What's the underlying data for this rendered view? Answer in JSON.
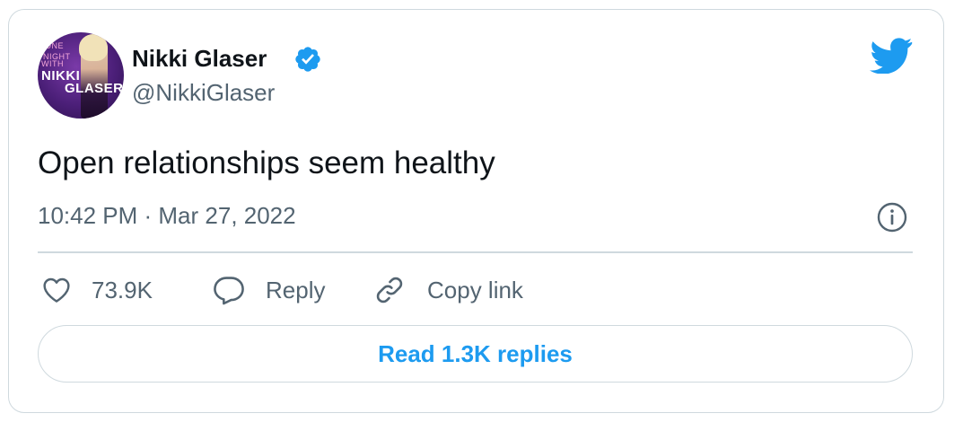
{
  "author": {
    "name": "Nikki Glaser",
    "handle": "@NikkiGlaser",
    "avatar_text": [
      "ONE",
      "NIGHT",
      "WITH",
      "NIKKI",
      "GLASER"
    ]
  },
  "tweet": {
    "text": "Open relationships seem healthy",
    "timestamp": "10:42 PM · Mar 27, 2022"
  },
  "actions": {
    "like_count": "73.9K",
    "reply_label": "Reply",
    "copy_link_label": "Copy link"
  },
  "read_replies_label": "Read 1.3K replies",
  "icons": {
    "brand": "twitter-bird-icon",
    "verified": "verified-badge-icon",
    "info": "info-icon",
    "like": "heart-icon",
    "reply": "speech-bubble-icon",
    "copy": "link-icon"
  },
  "colors": {
    "accent": "#1d9bf0",
    "text_primary": "#0f1419",
    "text_secondary": "#536471",
    "border": "#cfd9de"
  }
}
